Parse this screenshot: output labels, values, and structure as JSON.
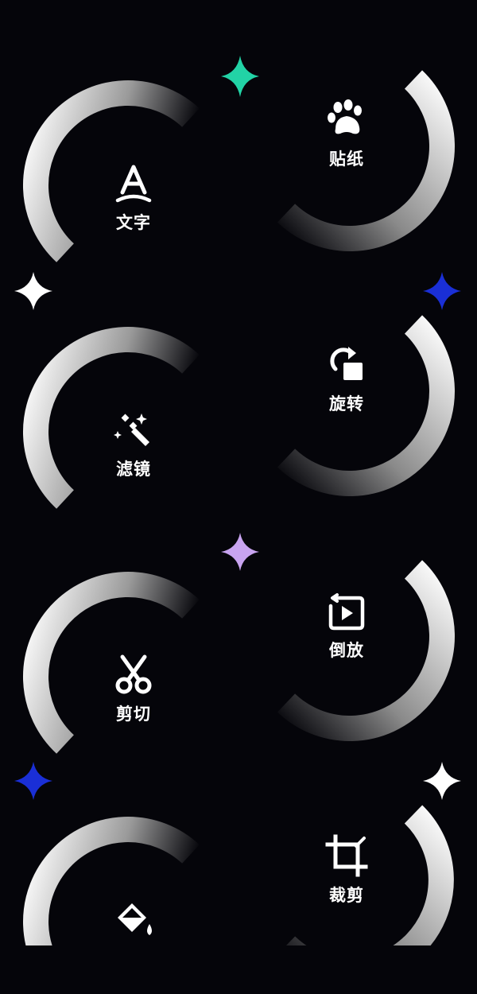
{
  "tools": [
    {
      "id": "text",
      "label": "文字",
      "icon": "text-a-icon"
    },
    {
      "id": "sticker",
      "label": "贴纸",
      "icon": "paw-icon"
    },
    {
      "id": "filter",
      "label": "滤镜",
      "icon": "magic-wand-icon"
    },
    {
      "id": "rotate",
      "label": "旋转",
      "icon": "rotate-icon"
    },
    {
      "id": "cut",
      "label": "剪切",
      "icon": "scissors-icon"
    },
    {
      "id": "reverse",
      "label": "倒放",
      "icon": "reverse-play-icon"
    },
    {
      "id": "crop",
      "label": "裁剪",
      "icon": "crop-icon"
    },
    {
      "id": "fill",
      "label": "",
      "icon": "paint-bucket-icon"
    }
  ],
  "colors": {
    "background": "#05050a",
    "sparkle_green": "#22d3a6",
    "sparkle_white": "#ffffff",
    "sparkle_blue": "#1a2fd6",
    "sparkle_purple": "#c8a4f0",
    "text": "#ffffff"
  }
}
